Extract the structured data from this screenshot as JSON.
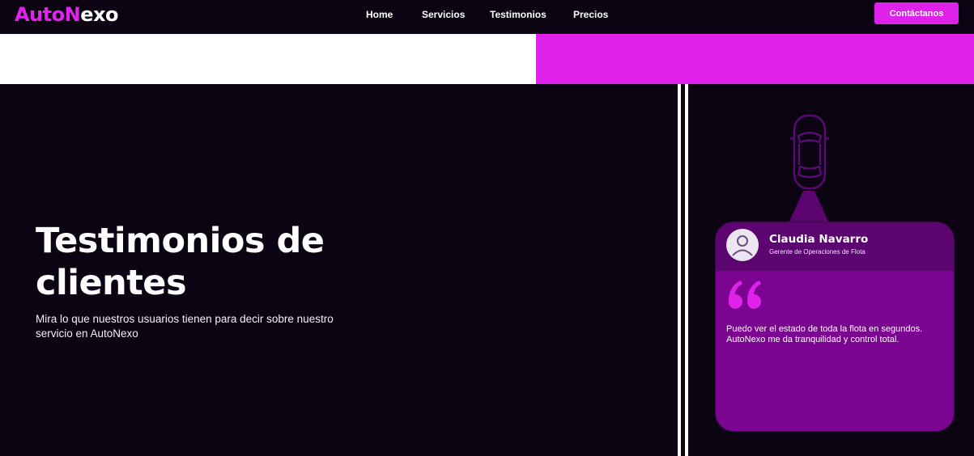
{
  "brand": {
    "part1": "Auto",
    "part2": "N",
    "part3": "exo"
  },
  "nav": {
    "home": "Home",
    "servicios": "Servicios",
    "testimonios": "Testimonios",
    "precios": "Precios"
  },
  "cta_label": "Contáctanos",
  "hero": {
    "title": "Testimonios de clientes",
    "subtitle": "Mira lo que nuestros usuarios tienen para decir sobre nuestro servicio en AutoNexo"
  },
  "testimonial": {
    "name": "Claudia Navarro",
    "role": "Gerente de Operaciones de Flota",
    "quote": "Puedo ver el estado de toda la flota en segundos. AutoNexo me da tranquilidad y control total."
  },
  "icons": {
    "car": "car-top-view-icon",
    "avatar": "user-avatar-icon",
    "quote": "quote-mark-icon"
  },
  "colors": {
    "background": "#0c0413",
    "accent": "#e021eb",
    "card": "#7b0591",
    "card_header": "#5c0470"
  }
}
